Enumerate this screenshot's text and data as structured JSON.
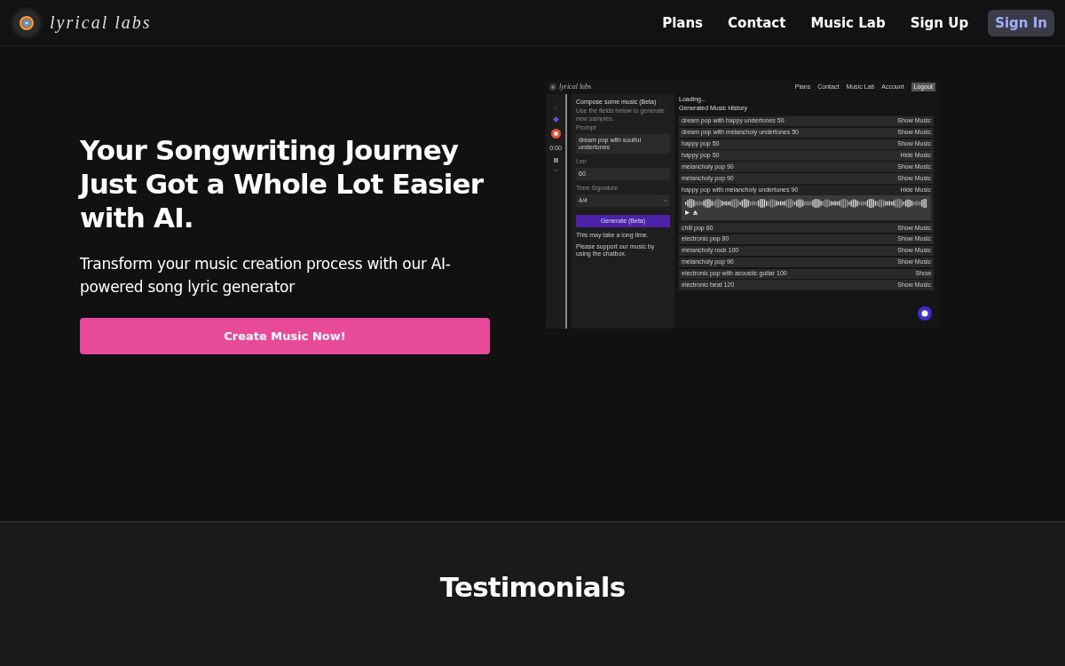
{
  "header": {
    "logo_text": "lyrical labs",
    "nav": [
      {
        "label": "Plans",
        "kind": "link"
      },
      {
        "label": "Contact",
        "kind": "link"
      },
      {
        "label": "Music Lab",
        "kind": "link"
      },
      {
        "label": "Sign Up",
        "kind": "link"
      },
      {
        "label": "Sign In",
        "kind": "button"
      }
    ]
  },
  "hero": {
    "title": "Your Songwriting Journey Just Got a Whole Lot Easier with AI.",
    "subtitle": "Transform your music creation process with our AI-powered song lyric generator",
    "cta": "Create Music Now!"
  },
  "preview": {
    "logo_text": "lyrical labs",
    "nav": [
      {
        "label": "Plans",
        "kind": "link"
      },
      {
        "label": "Contact",
        "kind": "link"
      },
      {
        "label": "Music Lab",
        "kind": "link"
      },
      {
        "label": "Account",
        "kind": "link"
      },
      {
        "label": "Logout",
        "kind": "button"
      }
    ],
    "timer": "0:00",
    "form": {
      "title": "Compose some music (Beta)",
      "hint": "Use the fields below to generate new samples.",
      "fields": [
        {
          "label": "Prompt",
          "value": "dream pop with soulful undertones",
          "kind": "text"
        },
        {
          "label": "Len",
          "value": "60",
          "kind": "text"
        },
        {
          "label": "Time Signature",
          "value": "4/4",
          "kind": "select"
        }
      ],
      "button": "Generate (Beta)",
      "notes": [
        "This may take a long time.",
        "Please support our music by using the chatbox."
      ]
    },
    "status": "Loading...",
    "history_title": "Generated Music History",
    "rows": [
      {
        "name": "dream pop with happy undertones 50",
        "action": "Show Music",
        "expanded": false
      },
      {
        "name": "dream pop with melancholy undertones 50",
        "action": "Show Music",
        "expanded": false
      },
      {
        "name": "happy pop 50",
        "action": "Show Music",
        "expanded": false
      },
      {
        "name": "happy pop 50",
        "action": "Hide Music",
        "expanded": false
      },
      {
        "name": "melancholy pop 90",
        "action": "Show Music",
        "expanded": false
      },
      {
        "name": "melancholy pop 90",
        "action": "Show Music",
        "expanded": false
      },
      {
        "name": "happy pop with melancholy undertones 90",
        "action": "Hide Music",
        "expanded": true
      },
      {
        "name": "chill pop 60",
        "action": "Show Music",
        "expanded": false
      },
      {
        "name": "electronic pop 80",
        "action": "Show Music",
        "expanded": false
      },
      {
        "name": "melancholy rock 100",
        "action": "Show Music",
        "expanded": false
      },
      {
        "name": "melancholy pop 90",
        "action": "Show Music",
        "expanded": false
      },
      {
        "name": "electronic pop with acoustic guitar 100",
        "action": "Show",
        "expanded": false
      },
      {
        "name": "electronic beat 120",
        "action": "Show Music",
        "expanded": false
      }
    ]
  },
  "testimonials": {
    "title": "Testimonials"
  }
}
